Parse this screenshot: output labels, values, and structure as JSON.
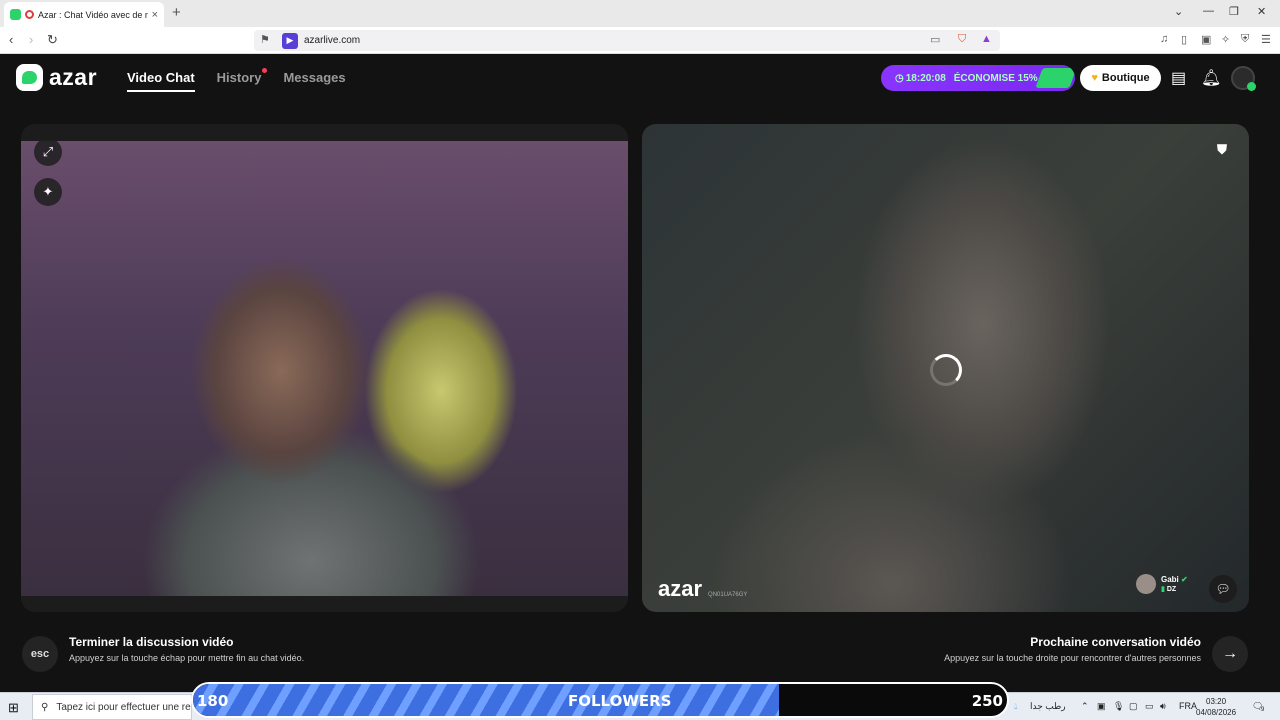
{
  "browser": {
    "tab_title": "Azar : Chat Vidéo avec de no",
    "close_tab": "×",
    "new_tab": "+",
    "url": "azarlive.com"
  },
  "header": {
    "logo_text": "azar",
    "nav": [
      {
        "label": "Video Chat",
        "active": true
      },
      {
        "label": "History",
        "notification": true
      },
      {
        "label": "Messages"
      }
    ],
    "promo_timer": "18:20:08",
    "promo_text": "ÉCONOMISE 15%",
    "boutique_label": "Boutique"
  },
  "remote": {
    "watermark": "azar",
    "watermark_code": "QN01UA76GY",
    "peer_name": "Gabi",
    "peer_country": "DZ"
  },
  "footer": {
    "esc_key": "esc",
    "end_title": "Terminer la discussion vidéo",
    "end_sub": "Appuyez sur la touche échap pour mettre fin au chat vidéo.",
    "next_title": "Prochaine conversation vidéo",
    "next_sub": "Appuyez sur la touche droite pour rencontrer d'autres personnes"
  },
  "overlay": {
    "start": "180",
    "label": "FOLLOWERS",
    "goal": "250",
    "progress_fraction": 0.72
  },
  "taskbar": {
    "search_placeholder": "Tapez ici pour effectuer une re",
    "weather": "رطب جدا",
    "lang": "FRA",
    "time": "03:20",
    "date": "04/08/2026",
    "notif_count": "9"
  },
  "colors": {
    "accent_green": "#2cd36b",
    "promo_purple": "#8a34ff",
    "progress_blue": "#3d6fe0"
  }
}
